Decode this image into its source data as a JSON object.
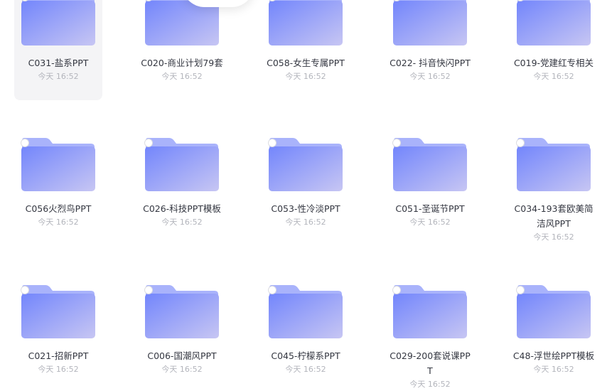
{
  "colors": {
    "folder_tab": "#a9b3fb",
    "folder_front_start": "#7386fc",
    "folder_front_end": "#c7c6f3",
    "hover_bg": "#f4f4f6",
    "name_text": "#333640",
    "time_text": "#b3b5bc"
  },
  "icon": "folder-icon",
  "rows": [
    {
      "items": [
        {
          "name": "C031-盐系PPT",
          "time": "今天 16:52",
          "selected": true
        },
        {
          "name": "C020-商业计划79套",
          "time": "今天 16:52"
        },
        {
          "name": "C058-女生专属PPT",
          "time": "今天 16:52"
        },
        {
          "name": "C022- 抖音快闪PPT",
          "time": "今天 16:52"
        },
        {
          "name": "C019-党建红专相关",
          "time": "今天 16:52"
        }
      ]
    },
    {
      "items": [
        {
          "name": "C056火烈鸟PPT",
          "time": "今天 16:52"
        },
        {
          "name": "C026-科技PPT模板",
          "time": "今天 16:52"
        },
        {
          "name": "C053-性冷淡PPT",
          "time": "今天 16:52"
        },
        {
          "name": "C051-圣诞节PPT",
          "time": "今天 16:52"
        },
        {
          "name": "C034-193套欧美简洁风PPT",
          "time": "今天 16:52"
        }
      ]
    },
    {
      "items": [
        {
          "name": "C021-招新PPT",
          "time": "今天 16:52"
        },
        {
          "name": "C006-国潮风PPT",
          "time": "今天 16:52"
        },
        {
          "name": "C045-柠檬系PPT",
          "time": "今天 16:52"
        },
        {
          "name": "C029-200套说课PPT",
          "time": "今天 16:52"
        },
        {
          "name": "C48-浮世绘PPT模板",
          "time": "今天 16:52"
        }
      ]
    }
  ]
}
